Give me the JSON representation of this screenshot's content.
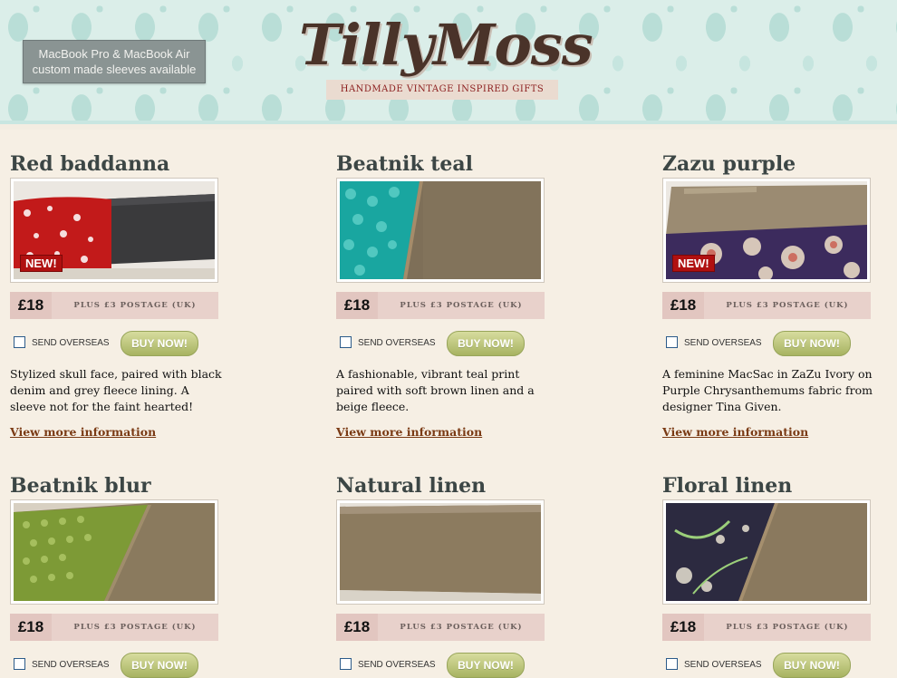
{
  "header": {
    "promo_line1": "MacBook Pro & MacBook Air",
    "promo_line2": "custom made sleeves available",
    "logo_text": "TillyMoss",
    "tagline": "HANDMADE VINTAGE INSPIRED GIFTS"
  },
  "common": {
    "postage": "PLUS £3 POSTAGE (UK)",
    "overseas_label": "SEND OVERSEAS",
    "buy_label": "BUY NOW!",
    "more_label": "View more information",
    "new_label": "NEW!"
  },
  "products": [
    {
      "title": "Red baddanna",
      "price": "£18",
      "is_new": true,
      "description": "Stylized skull face, paired with black denim and grey fleece lining. A sleeve not for the faint hearted!"
    },
    {
      "title": "Beatnik teal",
      "price": "£18",
      "is_new": false,
      "description": "A fashionable, vibrant teal print paired with soft brown linen and a beige fleece."
    },
    {
      "title": "Zazu purple",
      "price": "£18",
      "is_new": true,
      "description": "A feminine MacSac in ZaZu Ivory on Purple Chrysanthemums fabric from designer Tina Given."
    },
    {
      "title": "Beatnik blur",
      "price": "£18",
      "is_new": false,
      "description": ""
    },
    {
      "title": "Natural linen",
      "price": "£18",
      "is_new": false,
      "description": ""
    },
    {
      "title": "Floral linen",
      "price": "£18",
      "is_new": false,
      "description": ""
    }
  ]
}
